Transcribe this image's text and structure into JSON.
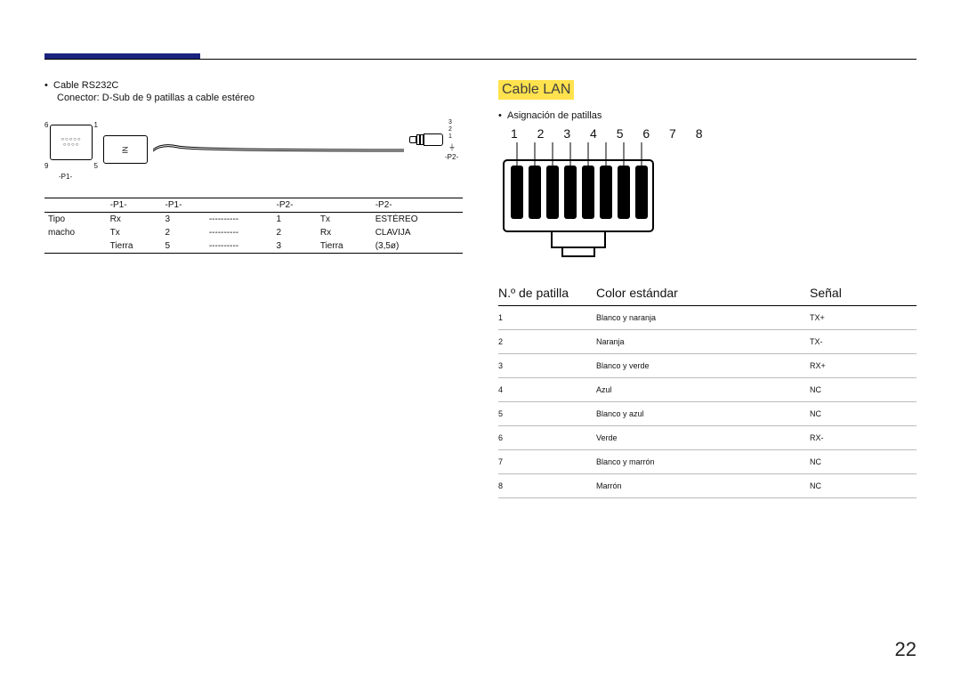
{
  "page_number": "22",
  "left": {
    "bullet": "Cable RS232C",
    "sub": "Conector: D-Sub de 9 patillas a cable estéreo",
    "dsub": {
      "l6": "6",
      "l1": "1",
      "l9": "9",
      "l5": "5",
      "p1": "-P1-",
      "in": "IN"
    },
    "jack": {
      "n3": "3",
      "n2": "2",
      "n1": "1",
      "ground": "⏚",
      "p2": "-P2-"
    },
    "table": {
      "h": [
        "-P1-",
        "-P1-",
        "-P2-",
        "-P2-"
      ],
      "r1": [
        "Tipo",
        "Rx",
        "3",
        "----------",
        "1",
        "Tx",
        "ESTÉREO"
      ],
      "r2": [
        "macho",
        "Tx",
        "2",
        "----------",
        "2",
        "Rx",
        "CLAVIJA"
      ],
      "r3": [
        "",
        "Tierra",
        "5",
        "----------",
        "3",
        "Tierra",
        "(3,5ø)"
      ]
    }
  },
  "right": {
    "heading": "Cable LAN",
    "bullet": "Asignación de patillas",
    "pin_numbers": "1 2 3 4 5 6 7 8",
    "table_head": {
      "c1": "N.º de patilla",
      "c2": "Color estándar",
      "c3": "Señal"
    }
  },
  "chart_data": {
    "type": "table",
    "title": "Cable LAN — Asignación de patillas",
    "columns": [
      "N.º de patilla",
      "Color estándar",
      "Señal"
    ],
    "rows": [
      [
        "1",
        "Blanco y naranja",
        "TX+"
      ],
      [
        "2",
        "Naranja",
        "TX-"
      ],
      [
        "3",
        "Blanco y verde",
        "RX+"
      ],
      [
        "4",
        "Azul",
        "NC"
      ],
      [
        "5",
        "Blanco y azul",
        "NC"
      ],
      [
        "6",
        "Verde",
        "RX-"
      ],
      [
        "7",
        "Blanco y marrón",
        "NC"
      ],
      [
        "8",
        "Marrón",
        "NC"
      ]
    ]
  }
}
